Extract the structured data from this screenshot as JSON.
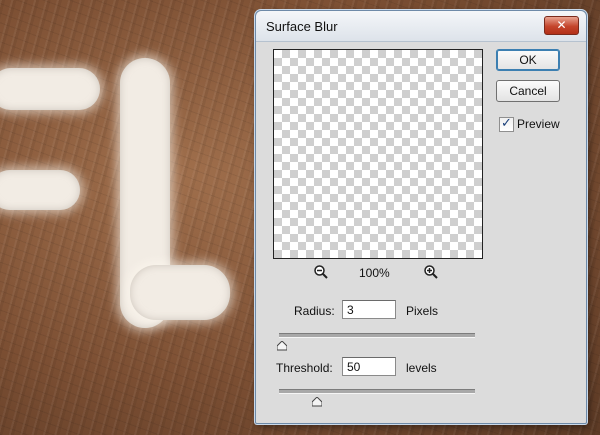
{
  "dialog": {
    "title": "Surface Blur",
    "close_label": "✕",
    "ok_label": "OK",
    "cancel_label": "Cancel",
    "preview_label": "Preview",
    "preview_checked": true,
    "zoom_level": "100%",
    "radius": {
      "label": "Radius:",
      "value": "3",
      "unit": "Pixels",
      "slider_fraction": 0.015
    },
    "threshold": {
      "label": "Threshold:",
      "value": "50",
      "unit": "levels",
      "slider_fraction": 0.196
    }
  },
  "icons": {
    "zoom_out": "zoom-out-icon",
    "zoom_in": "zoom-in-icon",
    "close": "close-icon",
    "checkmark": "checkmark-icon",
    "slider_thumb": "slider-thumb-icon"
  },
  "colors": {
    "dialog_bg": "#dcdcdc",
    "close_button": "#c4452c",
    "ok_focus": "#3c7fb1"
  }
}
